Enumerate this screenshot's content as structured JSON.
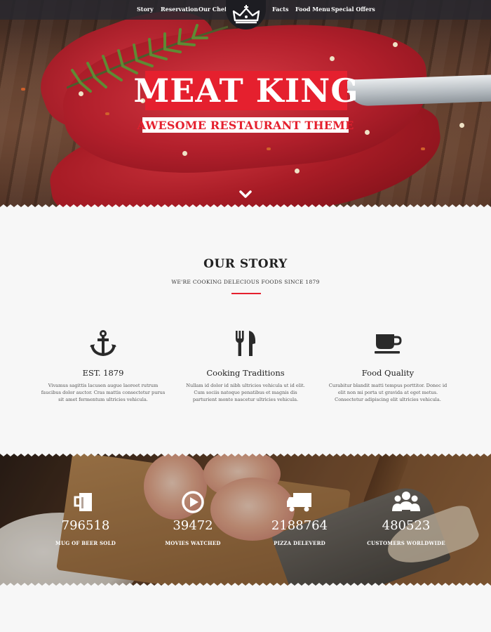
{
  "nav": {
    "items": [
      "Story",
      "Reservation",
      "Our Chefs",
      "Facts",
      "Food Menu",
      "Special Offers"
    ],
    "logo_icon": "crown-icon"
  },
  "hero": {
    "title": "MEAT KING",
    "subtitle": "AWESOME RESTAURANT THEME",
    "scroll_icon": "chevron-down-icon",
    "accent_color": "#e5202e"
  },
  "story": {
    "heading": "OUR STORY",
    "tagline": "WE'RE COOKING DELECIOUS FOODS SINCE 1879",
    "features": [
      {
        "icon": "anchor-icon",
        "title": "EST. 1879",
        "text": "Vivamus sagittis lacusen augue laoreet rutrum faucibus dolor auctor. Cras mattis consectetur purus sit amet fermentum ultricies vehicula."
      },
      {
        "icon": "fork-knife-icon",
        "title": "Cooking Traditions",
        "text": "Nullam id dolor id nibh ultricies vehicula ut id elit. Cum sociis natoque penatibus et magnis dis parturient monte nascetur ultricies vehicula."
      },
      {
        "icon": "coffee-cup-icon",
        "title": "Food Quality",
        "text": "Curabitur blandit matti tempus porttitor. Donec id elit non mi porta ut gravida at eget metus. Consectetur adipiscing elit ultricies vehicula."
      }
    ]
  },
  "stats": [
    {
      "icon": "beer-mug-icon",
      "value": "796518",
      "label": "MUG OF BEER SOLD"
    },
    {
      "icon": "play-icon",
      "value": "39472",
      "label": "MOVIES WATCHED"
    },
    {
      "icon": "truck-icon",
      "value": "2188764",
      "label": "PIZZA DELEVERD"
    },
    {
      "icon": "users-icon",
      "value": "480523",
      "label": "CUSTOMERS WORLDWIDE"
    }
  ]
}
